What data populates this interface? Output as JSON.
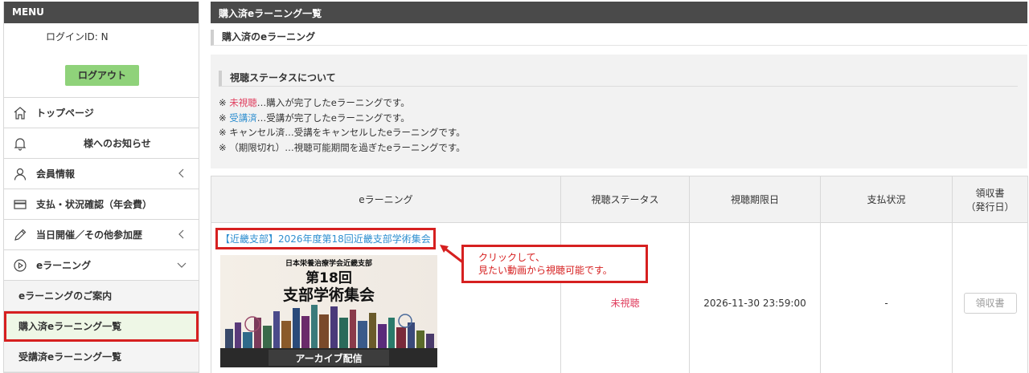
{
  "sidebar": {
    "menu_header": "MENU",
    "login_id": "ログインID: N",
    "logout_label": "ログアウト",
    "nav": [
      {
        "label": "トップページ",
        "icon": "home-icon"
      },
      {
        "label": "様へのお知らせ",
        "icon": "bell-icon"
      },
      {
        "label": "会員情報",
        "icon": "person-icon"
      },
      {
        "label": "支払・状況確認（年会費）",
        "icon": "card-icon"
      },
      {
        "label": "当日開催／その他参加歴",
        "icon": "pencil-icon"
      },
      {
        "label": "eラーニング",
        "icon": "play-circle-icon"
      }
    ],
    "sub_items": [
      {
        "label": "eラーニングのご案内"
      },
      {
        "label": "購入済eラーニング一覧"
      },
      {
        "label": "受講済eラーニング一覧"
      }
    ]
  },
  "main": {
    "page_title": "購入済eラーニング一覧",
    "section_title": "購入済のeラーニング",
    "status_box": {
      "title": "視聴ステータスについて",
      "lines": [
        {
          "prefix": "※ ",
          "term": "未視聴",
          "rest": "…購入が完了したeラーニングです。"
        },
        {
          "prefix": "※ ",
          "term": "受講済",
          "rest": "…受講が完了したeラーニングです。"
        },
        {
          "prefix": "※ ",
          "term": "キャンセル済",
          "rest": "…受講をキャンセルしたeラーニングです。"
        },
        {
          "prefix": "※ ",
          "term": "（期限切れ）",
          "rest": "…視聴可能期間を過ぎたeラーニングです。"
        }
      ],
      "colors": {
        "unviewed": "#e04060",
        "completed": "#2f8fd0"
      }
    },
    "table": {
      "headers": {
        "elearning": "eラーニング",
        "status": "視聴ステータス",
        "deadline": "視聴期限日",
        "payment": "支払状況",
        "receipt_line1": "領収書",
        "receipt_line2": "（発行日）"
      },
      "rows": [
        {
          "title": "【近畿支部】2026年度第18回近畿支部学術集会",
          "thumb": {
            "line1": "日本栄養治療学会近畿支部",
            "line2": "第18回",
            "line3": "支部学術集会",
            "banner": "アーカイブ配信"
          },
          "status": "未視聴",
          "deadline": "2026-11-30 23:59:00",
          "payment": "-",
          "receipt_button": "領収書"
        }
      ]
    },
    "callout": {
      "line1": "クリックして、",
      "line2": "見たい動画から視聴可能です。"
    }
  }
}
